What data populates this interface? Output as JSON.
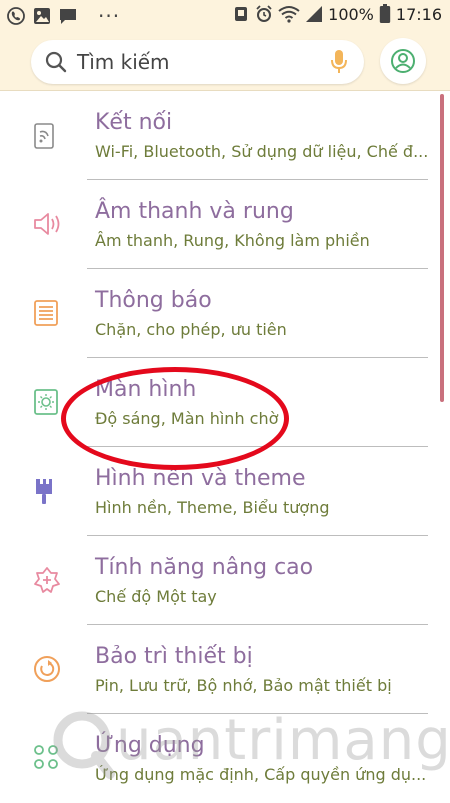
{
  "status_bar": {
    "battery": "100%",
    "time": "17:16",
    "more_dots": "···"
  },
  "search": {
    "placeholder": "Tìm kiếm"
  },
  "items": [
    {
      "title": "Kết nối",
      "subtitle": "Wi-Fi, Bluetooth, Sử dụng dữ liệu, Chế đ...",
      "icon": "connections-icon"
    },
    {
      "title": "Âm thanh và rung",
      "subtitle": "Âm thanh, Rung, Không làm phiền",
      "icon": "sound-icon"
    },
    {
      "title": "Thông báo",
      "subtitle": "Chặn, cho phép, ưu tiên",
      "icon": "notification-icon"
    },
    {
      "title": "Màn hình",
      "subtitle": "Độ sáng, Màn hình chờ",
      "icon": "display-icon"
    },
    {
      "title": "Hình nền và theme",
      "subtitle": "Hình nền, Theme, Biểu tượng",
      "icon": "wallpaper-brush-icon"
    },
    {
      "title": "Tính năng nâng cao",
      "subtitle": "Chế độ Một tay",
      "icon": "advanced-features-icon"
    },
    {
      "title": "Bảo trì thiết bị",
      "subtitle": "Pin, Lưu trữ, Bộ nhớ, Bảo mật thiết bị",
      "icon": "device-maintenance-icon"
    },
    {
      "title": "Ứng dụng",
      "subtitle": "Ứng dụng mặc định, Cấp quyền ứng dụ...",
      "icon": "apps-icon"
    }
  ],
  "watermark": {
    "text": "uantrimang"
  },
  "colors": {
    "header_bg": "#fdf3dd",
    "title": "#8e6d9e",
    "subtitle": "#6e7c3a",
    "highlight": "#e4091c",
    "scrollbar": "#c9707d"
  }
}
